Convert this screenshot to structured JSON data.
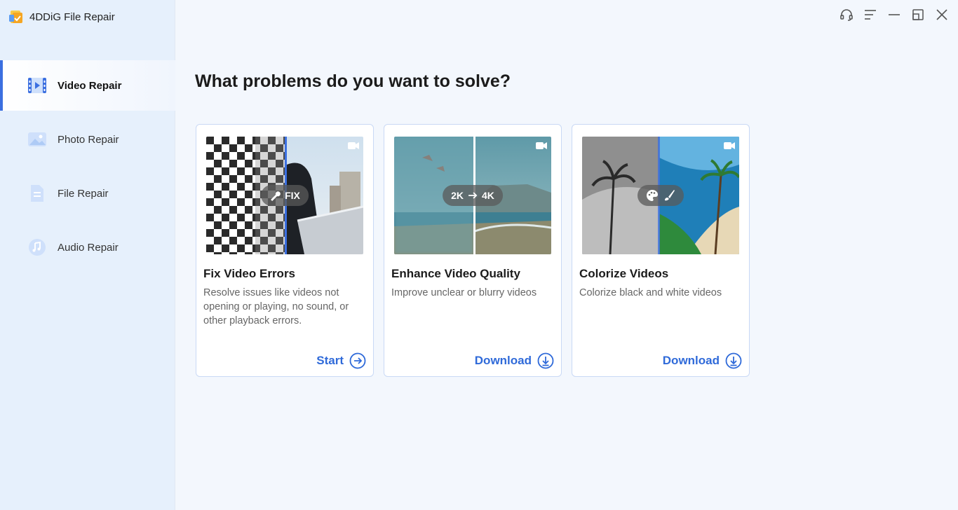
{
  "app": {
    "title": "4DDiG File Repair"
  },
  "sidebar": {
    "items": [
      {
        "label": "Video Repair",
        "icon": "video-icon",
        "active": true
      },
      {
        "label": "Photo Repair",
        "icon": "photo-icon",
        "active": false
      },
      {
        "label": "File Repair",
        "icon": "file-icon",
        "active": false
      },
      {
        "label": "Audio Repair",
        "icon": "music-icon",
        "active": false
      }
    ]
  },
  "window_controls": [
    "headset-icon",
    "menu-icon",
    "minimize-icon",
    "restore-icon",
    "close-icon"
  ],
  "main": {
    "heading": "What problems do you want to solve?",
    "cards": [
      {
        "title": "Fix Video Errors",
        "description": "Resolve issues like videos not opening or playing, no sound, or other playback errors.",
        "badge": "FIX",
        "action": "Start",
        "action_icon": "arrow-right-circle-icon"
      },
      {
        "title": "Enhance Video Quality",
        "description": "Improve unclear or blurry videos",
        "badge_from": "2K",
        "badge_to": "4K",
        "action": "Download",
        "action_icon": "download-circle-icon"
      },
      {
        "title": "Colorize Videos",
        "description": "Colorize black and white videos",
        "action": "Download",
        "action_icon": "download-circle-icon"
      }
    ]
  },
  "colors": {
    "accent": "#2f6ad9",
    "sidebar_bg": "#e6f0fc",
    "main_bg": "#f3f7fd",
    "card_border": "#c9d9f5"
  }
}
